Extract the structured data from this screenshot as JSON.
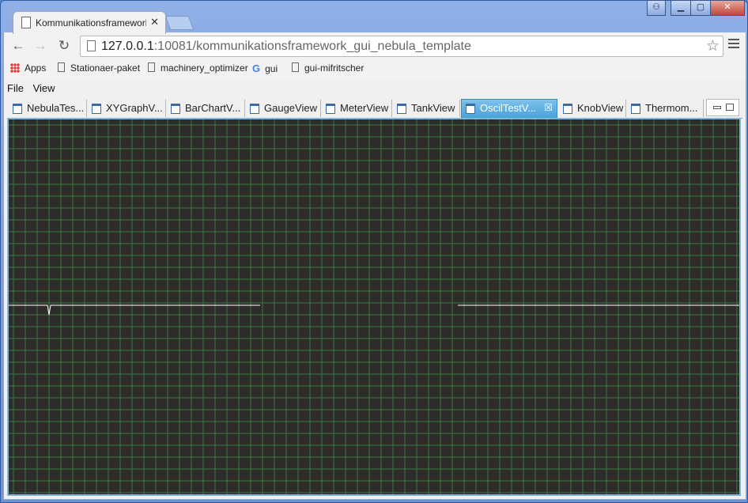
{
  "browser": {
    "tab_title": "Kommunikationsframework_",
    "url_host": "127.0.0.1",
    "url_rest": ":10081/kommunikationsframework_gui_nebula_template",
    "bookmarks": [
      {
        "label": "Apps",
        "icon": "apps-grid-icon"
      },
      {
        "label": "Stationaer-paket",
        "icon": "page-icon"
      },
      {
        "label": "machinery_optimizer",
        "icon": "page-icon"
      },
      {
        "label": "gui",
        "icon": "google-icon"
      },
      {
        "label": "gui-mifritscher",
        "icon": "page-icon"
      }
    ]
  },
  "app": {
    "menu": [
      "File",
      "View"
    ],
    "view_tabs": [
      {
        "label": "NebulaTes..."
      },
      {
        "label": "XYGraphV..."
      },
      {
        "label": "BarChartV..."
      },
      {
        "label": "GaugeView"
      },
      {
        "label": "MeterView"
      },
      {
        "label": "TankView"
      },
      {
        "label": "OscilTestV...",
        "active": true
      },
      {
        "label": "KnobView"
      },
      {
        "label": "Thermom..."
      }
    ]
  },
  "colors": {
    "scope_background": "#2e2b2b",
    "scope_grid": "#3f7a3f",
    "trace": "#ffffff",
    "active_tab": "#4aa3d9"
  }
}
